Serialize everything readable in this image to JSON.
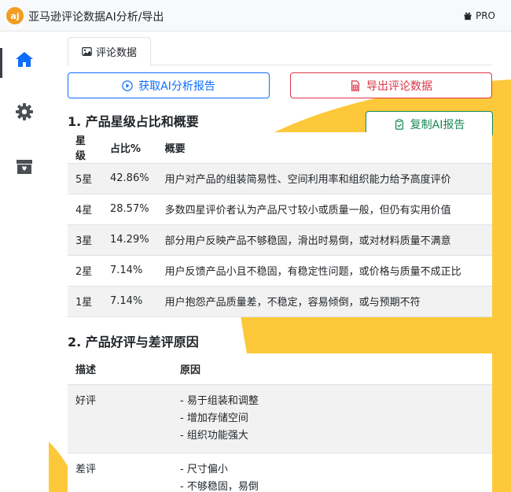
{
  "header": {
    "logo_text": "aj",
    "title": "亚马逊评论数据AI分析/导出",
    "pro_label": "PRO",
    "pro_icon": "gift-icon"
  },
  "sidebar": {
    "items": [
      {
        "name": "home",
        "icon": "home-icon",
        "active": true
      },
      {
        "name": "settings",
        "icon": "gear-icon",
        "active": false
      },
      {
        "name": "store",
        "icon": "box-icon",
        "active": false
      }
    ]
  },
  "colors": {
    "accent_blue": "#0d6efd",
    "danger_red": "#dc3545",
    "success_green": "#198754",
    "background_yellow": "#fdc93a"
  },
  "tabs": [
    {
      "label": "评论数据",
      "icon": "image-icon",
      "active": true
    }
  ],
  "actions": {
    "ai_report_label": "获取AI分析报告",
    "export_label": "导出评论数据",
    "copy_report_label": "复制AI报告"
  },
  "section1": {
    "title": "1. 产品星级占比和概要",
    "headers": [
      "星级",
      "占比%",
      "概要"
    ],
    "rows": [
      {
        "star": "5星",
        "percent": "42.86%",
        "summary": "用户对产品的组装简易性、空间利用率和组织能力给予高度评价"
      },
      {
        "star": "4星",
        "percent": "28.57%",
        "summary": "多数四星评价者认为产品尺寸较小或质量一般，但仍有实用价值"
      },
      {
        "star": "3星",
        "percent": "14.29%",
        "summary": "部分用户反映产品不够稳固，滑出时易倒，或对材料质量不满意"
      },
      {
        "star": "2星",
        "percent": "7.14%",
        "summary": "用户反馈产品小且不稳固，有稳定性问题，或价格与质量不成正比"
      },
      {
        "star": "1星",
        "percent": "7.14%",
        "summary": "用户抱怨产品质量差，不稳定，容易倾倒，或与预期不符"
      }
    ]
  },
  "section2": {
    "title": "2. 产品好评与差评原因",
    "headers": [
      "描述",
      "原因"
    ],
    "rows": [
      {
        "desc": "好评",
        "reasons": [
          "- 易于组装和调整",
          "- 增加存储空间",
          "- 组织功能强大"
        ]
      },
      {
        "desc": "差评",
        "reasons": [
          "- 尺寸偏小",
          "- 不够稳固，易倒"
        ]
      }
    ]
  }
}
